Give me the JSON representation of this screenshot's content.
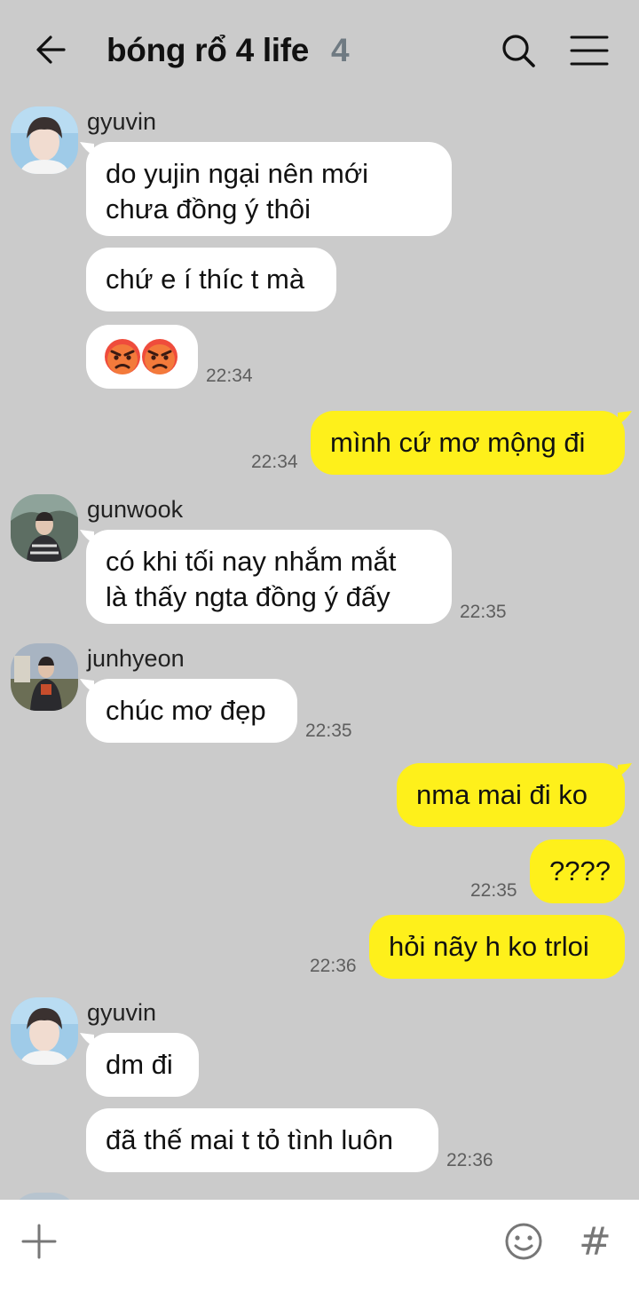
{
  "header": {
    "title": "bóng rổ 4 life",
    "member_count": "4"
  },
  "messages": {
    "m1": {
      "sender": "gyuvin",
      "line1": "do yujin ngại nên mới",
      "line2": "chưa đồng ý thôi"
    },
    "m2": {
      "text": "chứ e í thíc t mà"
    },
    "m3": {
      "emoji": "angry-face angry-face",
      "time": "22:34"
    },
    "m4": {
      "text": "mình cứ mơ mộng đi",
      "time": "22:34"
    },
    "m5": {
      "sender": "gunwook",
      "line1": "có khi tối nay nhắm mắt",
      "line2": "là thấy ngta đồng ý đấy",
      "time": "22:35"
    },
    "m6": {
      "sender": "junhyeon",
      "text": "chúc mơ đẹp",
      "time": "22:35"
    },
    "m7": {
      "text": "nma mai đi ko"
    },
    "m8": {
      "text": "????",
      "time": "22:35"
    },
    "m9": {
      "text": "hỏi nãy h ko trloi",
      "time": "22:36"
    },
    "m10": {
      "sender": "gyuvin",
      "text": "dm đi"
    },
    "m11": {
      "text": "đã thế mai t tỏ tình luôn",
      "time": "22:36"
    }
  },
  "input_bar": {
    "plus_icon": "plus-icon",
    "emoji_icon": "smiley-icon",
    "hash_label": "#"
  },
  "colors": {
    "background": "#cbcbcb",
    "incoming_bubble": "#ffffff",
    "outgoing_bubble": "#fef01b",
    "member_count": "#6f7a82"
  }
}
